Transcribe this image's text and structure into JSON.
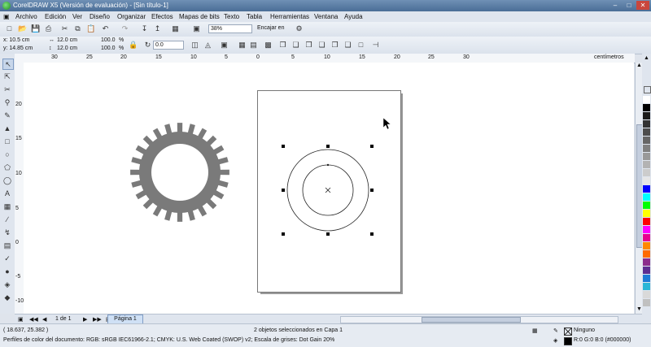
{
  "window": {
    "title": "CorelDRAW X5 (Versión de evaluación) - [Sin título-1]"
  },
  "menu": [
    "Archivo",
    "Edición",
    "Ver",
    "Diseño",
    "Organizar",
    "Efectos",
    "Mapas de bits",
    "Texto",
    "Tabla",
    "Herramientas",
    "Ventana",
    "Ayuda"
  ],
  "toolbar": {
    "zoom": "38%",
    "snap": "Encajar en"
  },
  "propbar": {
    "x": "x: 10.5 cm",
    "y": "y: 14.85 cm",
    "w": "12.0 cm",
    "h": "12.0 cm",
    "sx": "100.0",
    "sy": "100.0",
    "angle": "0.0",
    "pct": "%"
  },
  "ruler": {
    "units": "centímetros",
    "h_ticks": [
      "30",
      "25",
      "20",
      "15",
      "10",
      "5",
      "0",
      "5",
      "10",
      "15",
      "20",
      "25",
      "30"
    ],
    "v_ticks": [
      "20",
      "15",
      "10",
      "5",
      "0",
      "-5",
      "-10"
    ],
    "v_units": "centímetros"
  },
  "pagebar": {
    "pages": "1 de 1",
    "tab": "Página 1"
  },
  "status": {
    "coords": "( 18.637, 25.382 )",
    "selection": "2 objetos seleccionados en Capa 1",
    "profiles": "Perfiles de color del documento: RGB: sRGB IEC61966-2.1; CMYK: U.S. Web Coated (SWOP) v2; Escala de grises: Dot Gain 20%",
    "outline": "Ninguno",
    "fill_color": "R:0 G:0 B:0 (#000000)"
  },
  "palette_colors": [
    "#ffffff",
    "#000000",
    "#1a1a1a",
    "#333333",
    "#4d4d4d",
    "#666666",
    "#808080",
    "#999999",
    "#b3b3b3",
    "#cccccc",
    "#e6e6e6",
    "#0000ff",
    "#00ffff",
    "#00ff00",
    "#ffff00",
    "#ff0000",
    "#ff00ff",
    "#e80090",
    "#ff8800",
    "#ff6a00",
    "#8b2c8b",
    "#5c2d91",
    "#1e7bd6",
    "#2bb6d6",
    "#d9d9d9",
    "#c0c0c0"
  ],
  "colors": {
    "gear": "#7a7a7a",
    "accent": "#3b6aa0"
  }
}
